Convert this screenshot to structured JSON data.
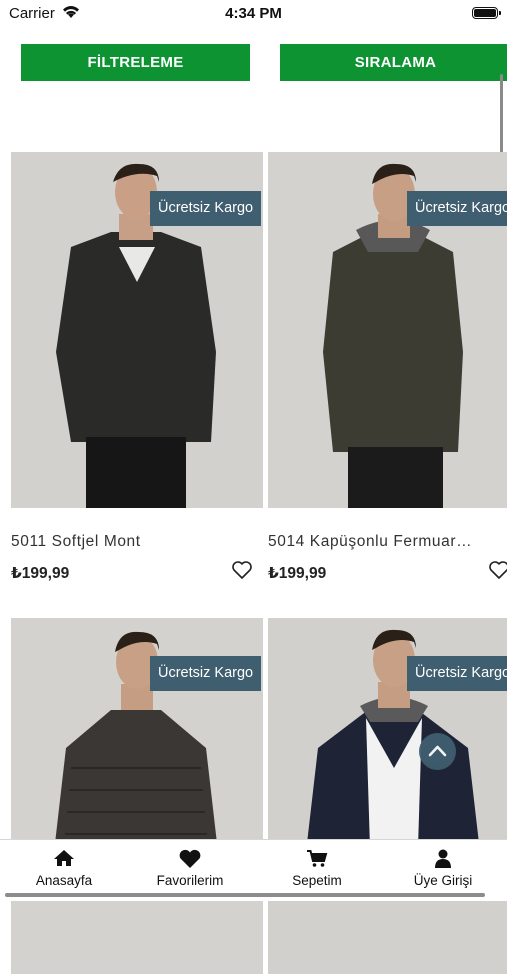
{
  "status_bar": {
    "carrier": "Carrier",
    "time": "4:34 PM"
  },
  "toolbar": {
    "filter_label": "FİLTRELEME",
    "sort_label": "SIRALAMA"
  },
  "products": [
    {
      "badge": "Ücretsiz Kargo",
      "name": "5011 Softjel Mont",
      "price": "₺199,99",
      "jacket_color": "#2a2a28"
    },
    {
      "badge": "Ücretsiz Kargo",
      "name": "5014 Kapüşonlu Fermuar…",
      "price": "₺199,99",
      "jacket_color": "#3d3c33"
    },
    {
      "badge": "Ücretsiz Kargo",
      "name": "",
      "price": "",
      "jacket_color": "#3b3735"
    },
    {
      "badge": "Ücretsiz Kargo",
      "name": "",
      "price": "",
      "jacket_color": "#1e2436"
    }
  ],
  "tabs": [
    {
      "label": "Anasayfa",
      "icon": "home-icon"
    },
    {
      "label": "Favorilerim",
      "icon": "heart-icon"
    },
    {
      "label": "Sepetim",
      "icon": "cart-icon"
    },
    {
      "label": "Üye Girişi",
      "icon": "user-icon"
    }
  ],
  "colors": {
    "primary_green": "#0e9333",
    "badge_bg": "#3f5e6f"
  }
}
